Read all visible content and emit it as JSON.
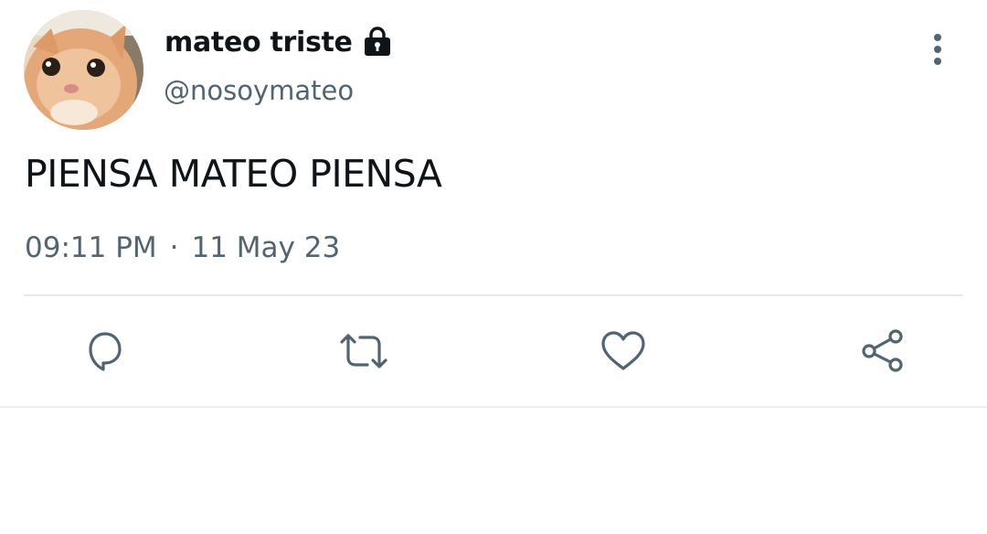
{
  "tweet": {
    "display_name": "mateo triste",
    "handle": "@nosoymateo",
    "protected": true,
    "text": "PIENSA MATEO PIENSA",
    "time": "09:11 PM",
    "separator": "·",
    "date": "11 May 23"
  },
  "icons": {
    "lock": "lock-icon",
    "more": "more-vertical-icon",
    "reply": "reply-icon",
    "retweet": "retweet-icon",
    "like": "heart-icon",
    "share": "share-icon"
  },
  "colors": {
    "text_primary": "#0f1419",
    "text_secondary": "#536471",
    "icon": "#536471",
    "divider": "#e7e9ea"
  }
}
